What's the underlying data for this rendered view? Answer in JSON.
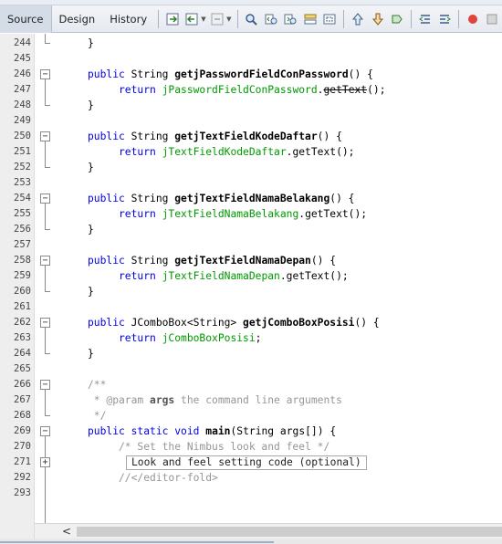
{
  "toolbar": {
    "tabs": [
      {
        "label": "Source",
        "active": true
      },
      {
        "label": "Design",
        "active": false
      },
      {
        "label": "History",
        "active": false
      }
    ]
  },
  "editor": {
    "line_numbers": [
      "244",
      "245",
      "246",
      "247",
      "248",
      "249",
      "250",
      "251",
      "252",
      "253",
      "254",
      "255",
      "256",
      "257",
      "258",
      "259",
      "260",
      "261",
      "262",
      "263",
      "264",
      "265",
      "266",
      "267",
      "268",
      "269",
      "270",
      "271",
      "292",
      "293"
    ],
    "lines": {
      "l244": "}",
      "l246_kw1": "public",
      "l246_type": " String ",
      "l246_name": "getjPasswordFieldConPassword",
      "l246_rest": "() {",
      "l247_kw": "return",
      "l247_field": "jPasswordFieldConPassword",
      "l247_dot": ".",
      "l247_method": "getText",
      "l247_rest": "();",
      "l248": "}",
      "l250_kw1": "public",
      "l250_type": " String ",
      "l250_name": "getjTextFieldKodeDaftar",
      "l250_rest": "() {",
      "l251_kw": "return",
      "l251_field": "jTextFieldKodeDaftar",
      "l251_rest": ".getText();",
      "l252": "}",
      "l254_kw1": "public",
      "l254_type": " String ",
      "l254_name": "getjTextFieldNamaBelakang",
      "l254_rest": "() {",
      "l255_kw": "return",
      "l255_field": "jTextFieldNamaBelakang",
      "l255_rest": ".getText();",
      "l256": "}",
      "l258_kw1": "public",
      "l258_type": " String ",
      "l258_name": "getjTextFieldNamaDepan",
      "l258_rest": "() {",
      "l259_kw": "return",
      "l259_field": "jTextFieldNamaDepan",
      "l259_rest": ".getText();",
      "l260": "}",
      "l262_kw1": "public",
      "l262_type": " JComboBox<String> ",
      "l262_name": "getjComboBoxPosisi",
      "l262_rest": "() {",
      "l263_kw": "return",
      "l263_field": "jComboBoxPosisi",
      "l263_rest": ";",
      "l264": "}",
      "l266": "/**",
      "l267_pre": " * @param ",
      "l267_bold": "args",
      "l267_post": " the command line arguments",
      "l268": " */",
      "l269_kw1": "public",
      "l269_kw2": "static",
      "l269_kw3": "void",
      "l269_name": "main",
      "l269_rest": "(String args[]) {",
      "l270": "/* Set the Nimbus look and feel */",
      "l271_collapsed": "Look and feel setting code (optional)",
      "l292": "//</editor-fold>"
    }
  },
  "scrollbar": {
    "left_arrow": "<"
  },
  "colors": {
    "keyword": "#0000e6",
    "field": "#009900",
    "comment": "#969696",
    "gutter_bg": "#eeeeee",
    "toolbar_bg": "#e6eaf0"
  }
}
